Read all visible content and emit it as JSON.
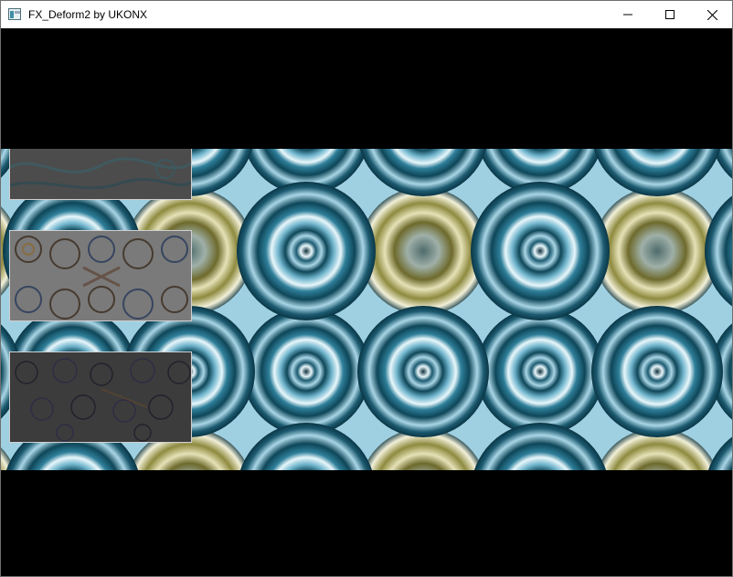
{
  "window": {
    "title": "FX_Deform2 by UKONX",
    "icon": "app-window-icon",
    "controls": {
      "minimize": "minimize-icon",
      "maximize": "maximize-icon",
      "close": "close-icon"
    }
  },
  "scene": {
    "description_colors": {
      "background": "#000000",
      "ring_dark": "#0e4658",
      "ring_mid": "#2f7f9a",
      "ring_light": "#a9d6e6",
      "highlight": "#e8f7fb",
      "olive": "#8e8a3f",
      "cream": "#e6e2b8"
    }
  }
}
